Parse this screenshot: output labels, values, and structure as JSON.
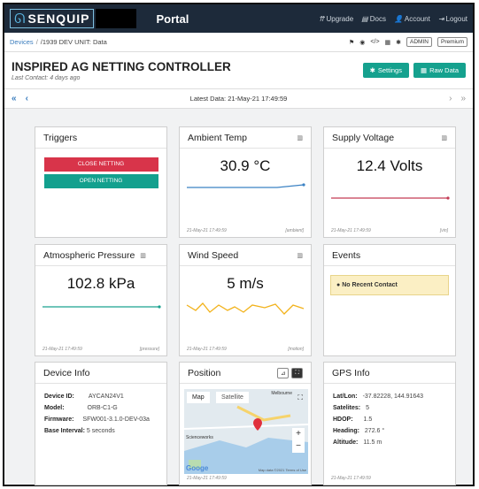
{
  "brand": {
    "name": "SENQUIP",
    "portal": "Portal"
  },
  "nav": {
    "upgrade": "Upgrade",
    "docs": "Docs",
    "account": "Account",
    "logout": "Logout"
  },
  "breadcrumb": {
    "devices": "Devices",
    "unit": "/1939 DEV UNIT: Data"
  },
  "toolbar": {
    "admin": "ADMIN",
    "premium": "Premium"
  },
  "page": {
    "title": "INSPIRED AG NETTING CONTROLLER",
    "last_contact": "Last Contact: 4 days ago",
    "settings": "Settings",
    "raw_data": "Raw Data"
  },
  "pager": {
    "latest": "Latest Data: 21-May-21 17:49:59"
  },
  "triggers": {
    "title": "Triggers",
    "close": "CLOSE NETTING",
    "open": "OPEN NETTING"
  },
  "ambient": {
    "title": "Ambient Temp",
    "value": "30.9 °C",
    "time": "21-May-21 17:49:59",
    "tag": "[ambient]"
  },
  "supply": {
    "title": "Supply Voltage",
    "value": "12.4 Volts",
    "time": "21-May-21 17:49:59",
    "tag": "[vin]"
  },
  "pressure": {
    "title": "Atmospheric Pressure",
    "value": "102.8 kPa",
    "time": "21-May-21 17:49:59",
    "tag": "[pressure]"
  },
  "wind": {
    "title": "Wind Speed",
    "value": "5 m/s",
    "time": "21-May-21 17:49:59",
    "tag": "[motion]"
  },
  "events": {
    "title": "Events",
    "message": "No Recent Contact"
  },
  "device": {
    "title": "Device Info",
    "rows": [
      {
        "k": "Device ID:",
        "v": "AYCAN24V1"
      },
      {
        "k": "Model:",
        "v": "ORB-C1-G"
      },
      {
        "k": "Firmware:",
        "v": "SFW001-3.1.0-DEV-03a"
      },
      {
        "k": "Base Interval:",
        "v": "5 seconds"
      }
    ]
  },
  "position": {
    "title": "Position",
    "map": "Map",
    "satellite": "Satellite",
    "footer_time": "21-May-21 17:49:59",
    "place1": "Melbourne",
    "place2": "Scienceworks",
    "place3": "Googe",
    "attrib": "Map data ©2021  Terms of Use"
  },
  "gps": {
    "title": "GPS Info",
    "rows": [
      {
        "k": "Lat/Lon:",
        "v": "-37.82228, 144.91643"
      },
      {
        "k": "Satelites:",
        "v": "5"
      },
      {
        "k": "HDOP:",
        "v": "1.5"
      },
      {
        "k": "Heading:",
        "v": "272.6 °"
      },
      {
        "k": "Altitude:",
        "v": "11.5 m"
      }
    ],
    "time": "21-May-21 17:49:59"
  }
}
